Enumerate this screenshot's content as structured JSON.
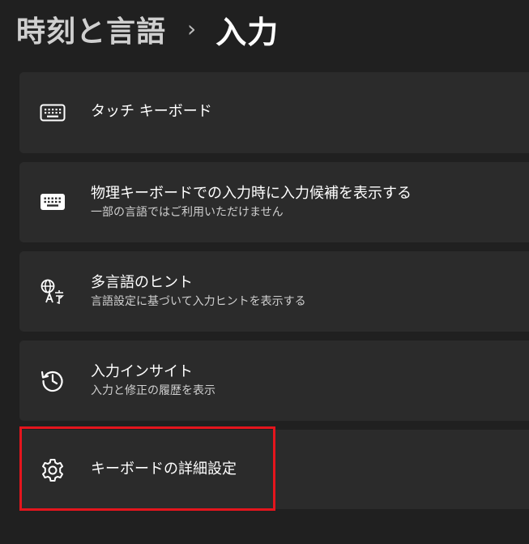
{
  "breadcrumb": {
    "parent": "時刻と言語",
    "separator": "›",
    "current": "入力"
  },
  "cards": [
    {
      "id": "touch-keyboard",
      "icon": "keyboard-outline-icon",
      "title": "タッチ キーボード",
      "subtitle": ""
    },
    {
      "id": "physical-keyboard-suggestions",
      "icon": "keyboard-filled-icon",
      "title": "物理キーボードでの入力時に入力候補を表示する",
      "subtitle": "一部の言語ではご利用いただけません"
    },
    {
      "id": "multilingual-hints",
      "icon": "language-icon",
      "title": "多言語のヒント",
      "subtitle": "言語設定に基づいて入力ヒントを表示する"
    },
    {
      "id": "typing-insights",
      "icon": "history-icon",
      "title": "入力インサイト",
      "subtitle": "入力と修正の履歴を表示"
    },
    {
      "id": "advanced-keyboard-settings",
      "icon": "gear-icon",
      "title": "キーボードの詳細設定",
      "subtitle": ""
    }
  ],
  "colors": {
    "background": "#202020",
    "card": "#2b2b2b",
    "highlight": "#e4151d"
  }
}
